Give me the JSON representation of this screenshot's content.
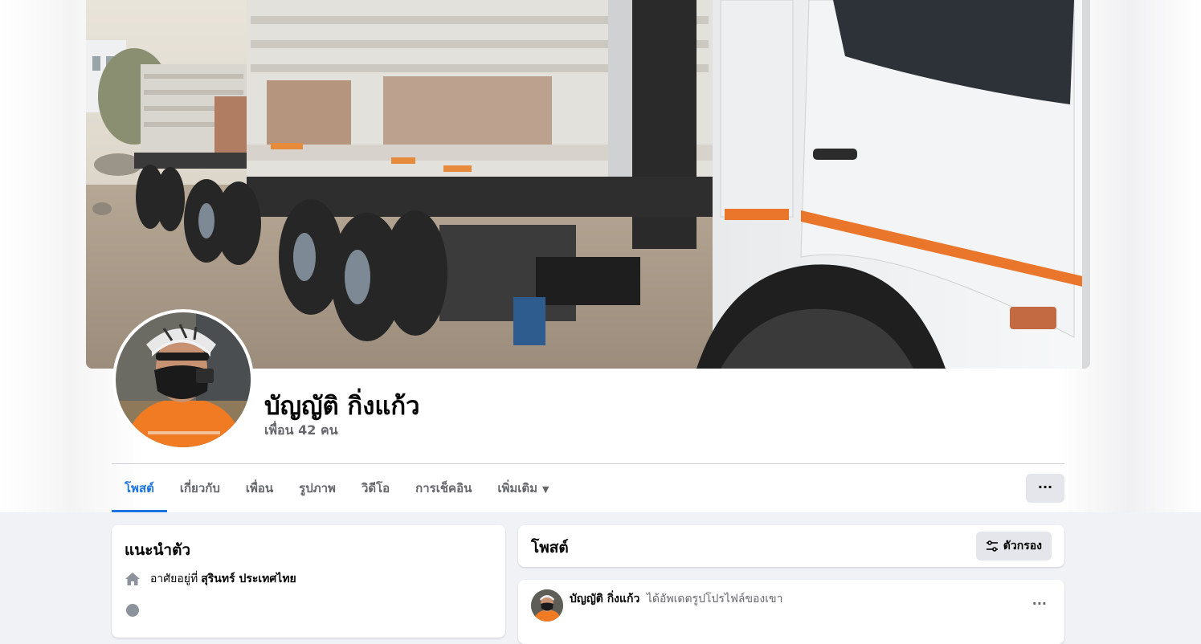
{
  "profile": {
    "name": "บัญญัติ กิ่งแก้ว",
    "friends": "เพื่อน 42 คน"
  },
  "tabs": [
    {
      "label": "โพสต์",
      "active": true
    },
    {
      "label": "เกี่ยวกับ"
    },
    {
      "label": "เพื่อน"
    },
    {
      "label": "รูปภาพ"
    },
    {
      "label": "วิดีโอ"
    },
    {
      "label": "การเช็คอิน"
    },
    {
      "label": "เพิ่มเติม"
    }
  ],
  "more_button": "···",
  "intro": {
    "title": "แนะนำตัว",
    "lives_prefix": "อาศัยอยู่ที่",
    "lives_place": "สุรินทร์ ประเทศไทย"
  },
  "posts": {
    "title": "โพสต์",
    "filter_label": "ตัวกรอง"
  },
  "post": {
    "author": "บัญญัติ กิ่งแก้ว",
    "action": "ได้อัพเดตรูปโปรไฟล์ของเขา",
    "more": "···"
  },
  "colors": {
    "accent": "#1b74e4",
    "page_bg": "#f0f2f5",
    "button_bg": "#e4e6eb"
  },
  "icons": [
    "home-icon",
    "filter-icon",
    "caret-down-icon",
    "more-icon"
  ]
}
